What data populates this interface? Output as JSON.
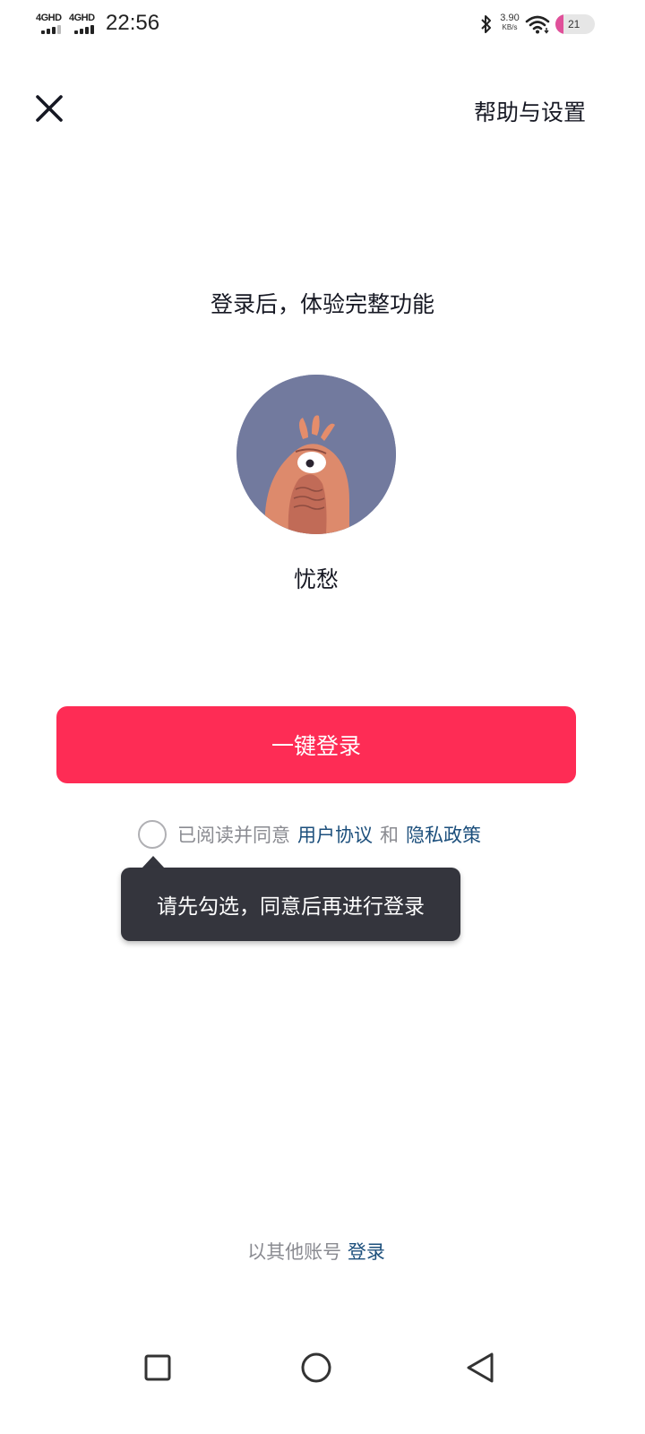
{
  "status_bar": {
    "sim1_label": "4GHD",
    "sim2_label": "4GHD",
    "time": "22:56",
    "net_speed_value": "3.90",
    "net_speed_unit": "KB/s",
    "battery_percent": "21",
    "battery_level": 0.21,
    "battery_color": "#e0509a"
  },
  "header": {
    "close_icon": "close-icon",
    "help_settings_label": "帮助与设置"
  },
  "main": {
    "headline": "登录后，体验完整功能",
    "avatar_icon": "avatar-monster-icon",
    "username": "忧愁",
    "one_click_login_label": "一键登录",
    "accent_color": "#fe2c55"
  },
  "agreement": {
    "prefix": "已阅读并同意",
    "user_agreement": "用户协议",
    "and": "和",
    "privacy_policy": "隐私政策",
    "link_color": "#1c4f7c"
  },
  "tooltip": {
    "text": "请先勾选，同意后再进行登录"
  },
  "footer": {
    "other_account_text": "以其他账号",
    "login_link": "登录"
  },
  "nav_bar": {
    "recent_icon": "square-icon",
    "home_icon": "circle-icon",
    "back_icon": "triangle-back-icon"
  }
}
